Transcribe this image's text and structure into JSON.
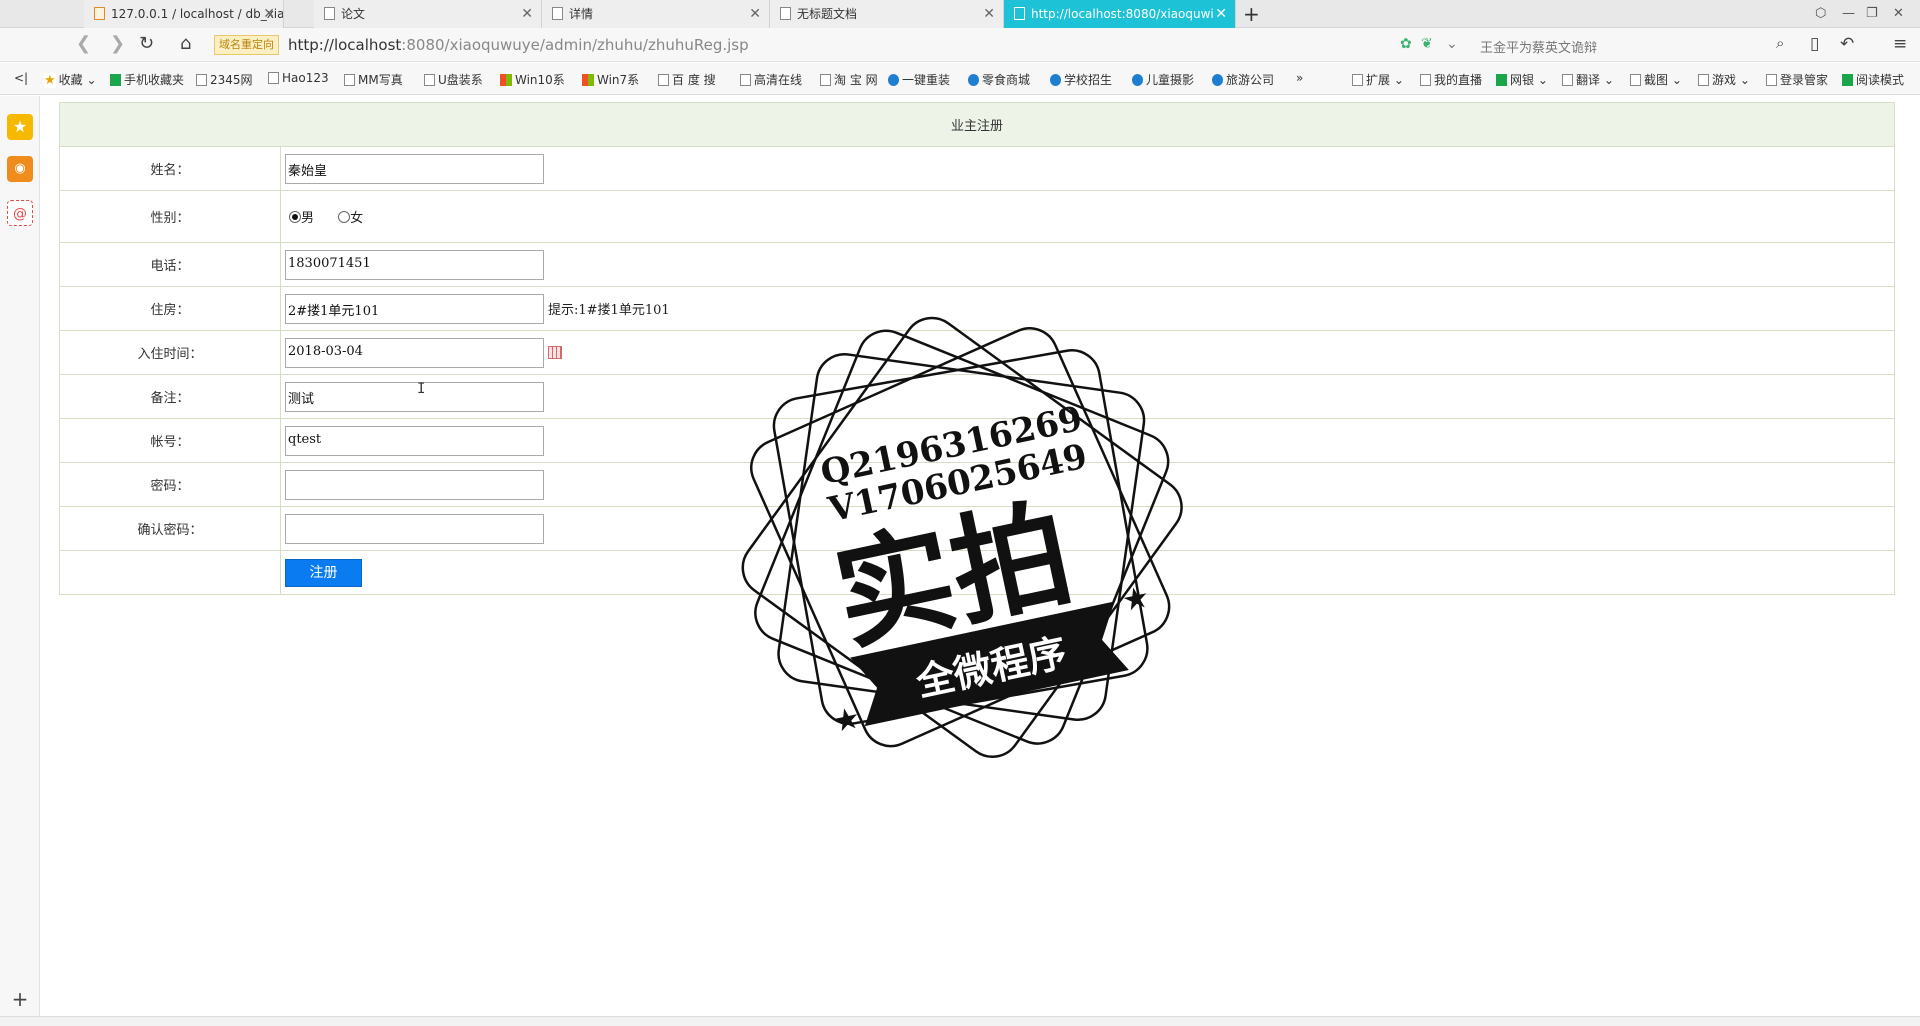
{
  "browser": {
    "tabs": [
      {
        "label": "127.0.0.1 / localhost / db_xiac",
        "icon": "phpmyadmin-icon",
        "active": false
      },
      {
        "label": "论文",
        "icon": "page-icon",
        "active": false
      },
      {
        "label": "详情",
        "icon": "page-icon",
        "active": false
      },
      {
        "label": "无标题文档",
        "icon": "page-icon",
        "active": false
      },
      {
        "label": "http://localhost:8080/xiaoquwi",
        "icon": "page-icon",
        "active": true
      }
    ],
    "new_tab": "+",
    "redirect_badge": "域名重定向",
    "url_host": "http://localhost",
    "url_path": ":8080/xiaoquwuye/admin/zhuhu/zhuhuReg.jsp",
    "search_placeholder": "王金平为蔡英文诡辩",
    "bookmarks": [
      {
        "label": "收藏",
        "icon": "star-icon"
      },
      {
        "label": "手机收藏夹",
        "icon": "phone-icon"
      },
      {
        "label": "2345网",
        "icon": "page-icon"
      },
      {
        "label": "Hao123",
        "icon": "page-icon"
      },
      {
        "label": "MM写真",
        "icon": "page-icon"
      },
      {
        "label": "U盘装系",
        "icon": "page-icon"
      },
      {
        "label": "Win10系",
        "icon": "windows-icon"
      },
      {
        "label": "Win7系",
        "icon": "windows-icon"
      },
      {
        "label": "百 度 搜",
        "icon": "page-icon"
      },
      {
        "label": "高清在线",
        "icon": "page-icon"
      },
      {
        "label": "淘 宝 网",
        "icon": "page-icon"
      },
      {
        "label": "一键重装",
        "icon": "app-icon"
      },
      {
        "label": "零食商城",
        "icon": "app-icon"
      },
      {
        "label": "学校招生",
        "icon": "app-icon"
      },
      {
        "label": "儿童摄影",
        "icon": "app-icon"
      },
      {
        "label": "旅游公司",
        "icon": "app-icon"
      }
    ],
    "bookmark_more": "»",
    "right_tools": [
      {
        "label": "扩展",
        "icon": "extension-icon"
      },
      {
        "label": "我的直播",
        "icon": "tv-icon"
      },
      {
        "label": "网银",
        "icon": "bank-icon"
      },
      {
        "label": "翻译",
        "icon": "translate-icon"
      },
      {
        "label": "截图",
        "icon": "scissors-icon"
      },
      {
        "label": "游戏",
        "icon": "gamepad-icon"
      },
      {
        "label": "登录管家",
        "icon": "key-icon"
      },
      {
        "label": "阅读模式",
        "icon": "book-icon"
      }
    ]
  },
  "form": {
    "title": "业主注册",
    "name_label": "姓名：",
    "name_value": "秦始皇",
    "gender_label": "性别：",
    "gender_options": [
      "男",
      "女"
    ],
    "gender_selected": "男",
    "phone_label": "电话：",
    "phone_value": "1830071451",
    "house_label": "住房：",
    "house_value": "2#搂1单元101",
    "house_hint": "提示:1#搂1单元101",
    "checkin_label": "入住时间：",
    "checkin_value": "2018-03-04",
    "remark_label": "备注：",
    "remark_value": "测试",
    "account_label": "帐号：",
    "account_value": "qtest",
    "password_label": "密码：",
    "password_value": "",
    "confirm_label": "确认密码：",
    "confirm_value": "",
    "submit_label": "注册"
  },
  "watermark": {
    "line1": "Q2196316269",
    "line2": "V1706025649",
    "big": "实拍",
    "ribbon": "全微程序"
  }
}
